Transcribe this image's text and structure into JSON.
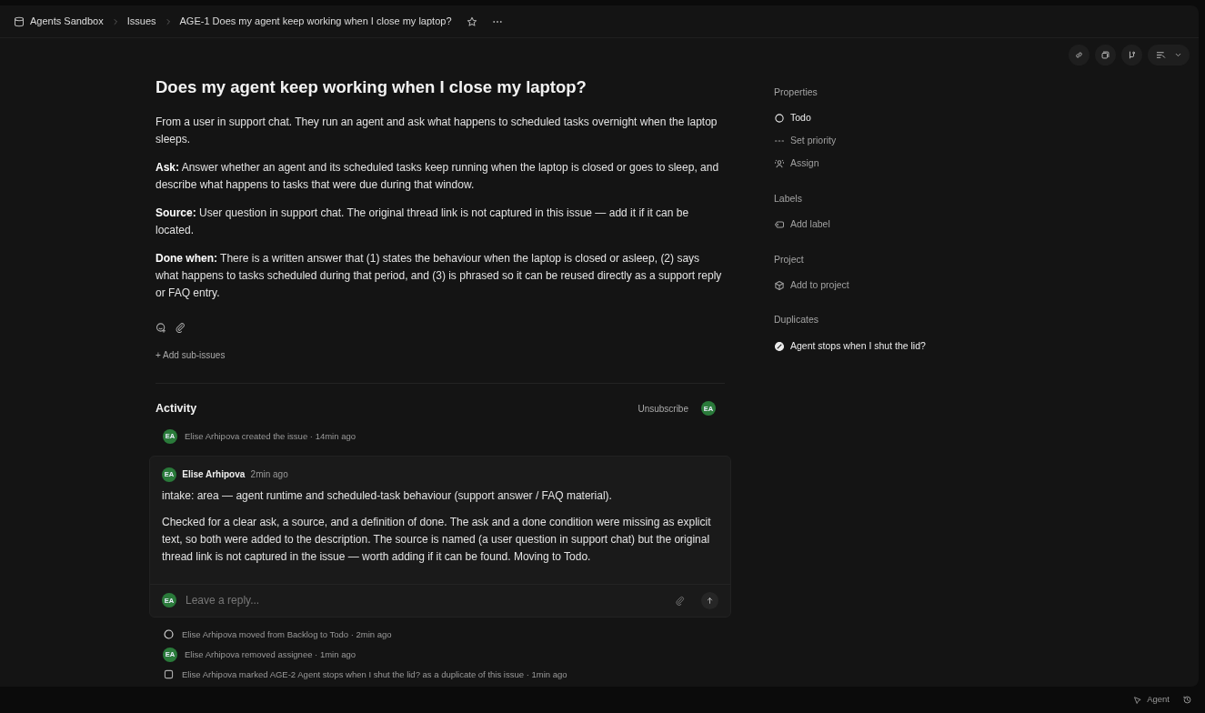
{
  "breadcrumbs": [
    {
      "label": "Agents Sandbox"
    },
    {
      "label": "Issues"
    },
    {
      "label": "AGE-1 Does my agent keep working when I close my laptop?"
    }
  ],
  "issue": {
    "title": "Does my agent keep working when I close my laptop?",
    "paragraphs": [
      "From a user in support chat. They run an agent and ask what happens to scheduled tasks overnight when the laptop sleeps.",
      "**Ask:** Answer whether an agent and its scheduled tasks keep running when the laptop is closed or goes to sleep, and describe what happens to tasks that were due during that window.",
      "**Source:** User question in support chat. The original thread link is not captured in this issue — add it if it can be located.",
      "**Done when:** There is a written answer that (1) states the behaviour when the laptop is closed or asleep, (2) says what happens to tasks scheduled during that period, and (3) is phrased so it can be reused directly as a support reply or FAQ entry."
    ],
    "add_sub_issues": "+ Add sub-issues"
  },
  "activity": {
    "title": "Activity",
    "unsubscribe": "Unsubscribe",
    "avatar": "EA",
    "events_before": [
      {
        "kind": "avatar",
        "avatar": "EA",
        "text": "Elise Arhipova created the issue · 14min ago"
      }
    ],
    "comment": {
      "avatar": "EA",
      "author": "Elise Arhipova",
      "time": "2min ago",
      "paragraphs": [
        "intake: area — agent runtime and scheduled-task behaviour (support answer / FAQ material).",
        "Checked for a clear ask, a source, and a definition of done. The ask and a done condition were missing as explicit text, so both were added to the description. The source is named (a user question in support chat) but the original thread link is not captured in the issue — worth adding if it can be found. Moving to Todo."
      ],
      "reply": {
        "avatar": "EA",
        "placeholder": "Leave a reply..."
      }
    },
    "events_after": [
      {
        "kind": "status",
        "text": "Elise Arhipova moved from Backlog to Todo · 2min ago"
      },
      {
        "kind": "avatar",
        "avatar": "EA",
        "text": "Elise Arhipova removed assignee · 1min ago"
      },
      {
        "kind": "duplicate",
        "text": "Elise Arhipova marked AGE-2 Agent stops when I shut the lid? as a duplicate of this issue · 1min ago"
      }
    ]
  },
  "sidebar": [
    {
      "heading": "Properties",
      "items": [
        {
          "kind": "status",
          "label": "Todo",
          "muted": false
        },
        {
          "kind": "priority",
          "label": "Set priority",
          "muted": true
        },
        {
          "kind": "assign",
          "label": "Assign",
          "muted": true
        }
      ]
    },
    {
      "heading": "Labels",
      "items": [
        {
          "kind": "label",
          "label": "Add label",
          "muted": true
        }
      ]
    },
    {
      "heading": "Project",
      "items": [
        {
          "kind": "project",
          "label": "Add to project",
          "muted": true
        }
      ]
    },
    {
      "heading": "Duplicates",
      "items": [
        {
          "kind": "duplicate",
          "label": "Agent stops when I shut the lid?",
          "muted": false
        }
      ]
    }
  ],
  "bottom_bar": {
    "agent": "Agent"
  }
}
